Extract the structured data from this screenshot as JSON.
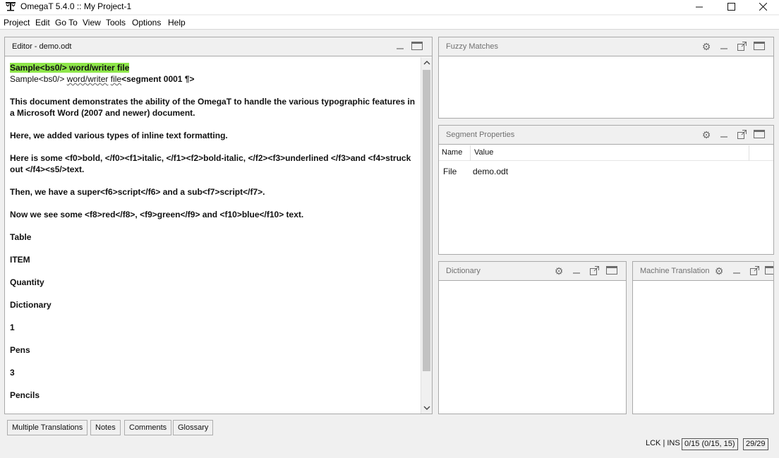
{
  "window": {
    "title": "OmegaT 5.4.0 :: My Project-1",
    "app_icon": "omegat-logo-icon"
  },
  "menu": [
    "Project",
    "Edit",
    "Go To",
    "View",
    "Tools",
    "Options",
    "Help"
  ],
  "editor": {
    "title": "Editor - demo.odt",
    "active_source": "Sample<bs0/> word/writer file",
    "active_target_prefix": "Sample<bs0/> ",
    "active_target_word1": "word/writer",
    "active_target_word2": "file",
    "active_target_marker": "<segment 0001 ¶>",
    "segments": [
      "This document demonstrates the ability of the OmegaT to handle the various typographic features in a Microsoft Word (2007 and newer) document.",
      "Here, we added various types of inline text formatting.",
      "Here is some <f0>bold, </f0><f1>italic, </f1><f2>bold-italic, </f2><f3>underlined </f3>and <f4>struck out </f4><s5/>text.",
      "Then, we have a super<f6>script</f6> and a sub<f7>script</f7>.",
      "Now we see some <f8>red</f8>, <f9>green</f9> and <f10>blue</f10> text.",
      "Table",
      "ITEM",
      "Quantity",
      "Dictionary",
      "1",
      "Pens",
      "3",
      "Pencils"
    ]
  },
  "fuzzy": {
    "title": "Fuzzy Matches"
  },
  "segment_properties": {
    "title": "Segment Properties",
    "col_name": "Name",
    "col_value": "Value",
    "rows": [
      {
        "name": "File",
        "value": "demo.odt"
      }
    ]
  },
  "dictionary": {
    "title": "Dictionary"
  },
  "machine_translation": {
    "title": "Machine Translation"
  },
  "bottom_tabs": [
    "Multiple Translations",
    "Notes",
    "Comments",
    "Glossary"
  ],
  "status": {
    "mode": "LCK | INS",
    "progress": "0/15 (0/15, 15)",
    "segments": "29/29"
  }
}
